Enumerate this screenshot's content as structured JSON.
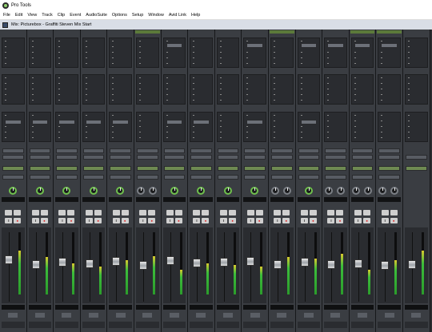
{
  "window": {
    "title": "Pro Tools"
  },
  "menu": [
    "File",
    "Edit",
    "View",
    "Track",
    "Clip",
    "Event",
    "AudioSuite",
    "Options",
    "Setup",
    "Window",
    "Avid Link",
    "Help"
  ],
  "document": {
    "title": "Mix: Picturebox - Graffiti Steven Mix Start"
  },
  "labels": {
    "inserts_ae": "INSERTS A-E",
    "inserts_fj": "INSERTS F-J",
    "sends_ae": "SENDS A-E",
    "io": "I / O",
    "auto": "AUTO",
    "no_group": "no group",
    "pan_label": "pan",
    "solo": "S",
    "mute": "M",
    "dyn": "dyn"
  },
  "strips": [
    {
      "name": "kick 1",
      "color": "#3a3d42",
      "send": "Bus 1",
      "input": "no input",
      "output": "Drums bus",
      "auto": "auto read",
      "pan": "< 0 >",
      "level_left": "-8.4",
      "level_right": "-6.5",
      "knob": "green",
      "fader_frac": 0.58,
      "meter_frac": 0.7
    },
    {
      "name": "snare 1",
      "color": "#3a3d42",
      "send": "Reverb",
      "input": "no input",
      "output": "Drums bus",
      "auto": "auto read",
      "pan": "< 0 >",
      "level_left": "-2.7",
      "level_right": "-6.5",
      "knob": "green",
      "fader_frac": 0.5,
      "meter_frac": 0.6
    },
    {
      "name": "rack tom 1",
      "color": "#3a3d42",
      "send": "Reverb",
      "input": "no input",
      "output": "Drums bus",
      "auto": "auto read",
      "pan": "< 0 >",
      "level_left": "-6.4",
      "level_right": "-11.4",
      "knob": "green",
      "fader_frac": 0.55,
      "meter_frac": 0.5
    },
    {
      "name": "floor tom 1",
      "color": "#3a3d42",
      "send": "Reverb",
      "input": "no input",
      "output": "Drums bus",
      "auto": "auto read",
      "pan": "< 100",
      "level_left": "-7.8",
      "level_right": "-0.7",
      "knob": "green",
      "fader_frac": 0.52,
      "meter_frac": 0.45
    },
    {
      "name": "overhead 1",
      "color": "#3a3d42",
      "send": "Reverb",
      "input": "no input",
      "output": "Drums bus",
      "auto": "auto read",
      "pan": "< 0 >",
      "level_left": "-4.6",
      "level_right": "-11.6",
      "knob": "green",
      "fader_frac": 0.56,
      "meter_frac": 0.55
    },
    {
      "name": "Drums bus",
      "color": "#5c7a3a",
      "send": "",
      "input": "Drums bus",
      "output": "1-2",
      "auto": "auto read",
      "pan": "<100 100>",
      "level_left": "0.1",
      "level_right": "-15.8",
      "knob": "gray",
      "fader_frac": 0.48,
      "meter_frac": 0.62
    },
    {
      "name": "bass 1",
      "color": "#3a3d42",
      "send": "Reverb",
      "input": "no input",
      "output": "1-2",
      "auto": "auto read",
      "pan": "< 0 >",
      "level_left": "-3.9",
      "level_right": "-6.3",
      "knob": "green",
      "fader_frac": 0.57,
      "meter_frac": 0.4,
      "insert": "Pusa Multi"
    },
    {
      "name": "gtr 1 1",
      "color": "#3a3d42",
      "send": "Reverb",
      "input": "no input",
      "output": "Gtr Bus",
      "auto": "auto read",
      "pan": "< 40",
      "level_left": "-6.4",
      "level_right": "-1.8",
      "knob": "green",
      "fader_frac": 0.53,
      "meter_frac": 0.5
    },
    {
      "name": "gtr 2 1",
      "color": "#3a3d42",
      "send": "",
      "input": "no input",
      "output": "Gtr Bus",
      "auto": "auto read",
      "pan": "40 >",
      "level_left": "-10.5",
      "level_right": "-3.4",
      "knob": "green",
      "fader_frac": 0.55,
      "meter_frac": 0.48
    },
    {
      "name": "gtr solo ta",
      "color": "#3a3d42",
      "send": "Reverb",
      "input": "no input",
      "output": "Gtr Bus",
      "auto": "auto read",
      "pan": "30 >",
      "level_left": "-2.5",
      "level_right": "-0.9",
      "knob": "green",
      "fader_frac": 0.56,
      "meter_frac": 0.45,
      "insert": "Pusa Mult"
    },
    {
      "name": "Gtr Bus",
      "color": "#5c7a3a",
      "send": "",
      "input": "Gtr Bus",
      "output": "1-2",
      "auto": "auto read",
      "pan": "<100 100>",
      "level_left": "-3.3",
      "level_right": "-6.2",
      "knob": "gray",
      "fader_frac": 0.5,
      "meter_frac": 0.6
    },
    {
      "name": "leadvocal 1",
      "color": "#3a3d42",
      "send": "Vox Reverb",
      "input": "no input",
      "output": "1-2",
      "auto": "auto read",
      "pan": "< 0 >",
      "level_left": "-2.6",
      "level_right": "-8.0",
      "knob": "green",
      "fader_frac": 0.54,
      "meter_frac": 0.58,
      "insert": "LIS EB"
    },
    {
      "name": "Reverb",
      "color": "#3a3d42",
      "send": "",
      "input": "Reverb",
      "output": "1-2",
      "auto": "auto read",
      "pan": "<100 100>",
      "level_left": "-4.3",
      "level_right": "-7.6",
      "knob": "gray",
      "fader_frac": 0.5,
      "meter_frac": 0.65,
      "insert": "AIR Reverb"
    },
    {
      "name": "Slap",
      "color": "#5c7a3a",
      "send": "",
      "input": "Slap",
      "output": "1-2",
      "auto": "auto read",
      "pan": "<100 100>",
      "level_left": "-5.7",
      "level_right": "-13.2",
      "knob": "gray",
      "fader_frac": 0.52,
      "meter_frac": 0.4,
      "insert": "AmpSlap"
    },
    {
      "name": "Reverb",
      "color": "#5c7a3a",
      "send": "",
      "input": "Reverb",
      "output": "1-2",
      "auto": "auto read",
      "pan": "<100 100>",
      "level_left": "-1.1",
      "level_right": "-9.9",
      "knob": "gray",
      "fader_frac": 0.49,
      "meter_frac": 0.55,
      "insert": "D-Verb"
    },
    {
      "name": "Master",
      "color": "#3a3d42",
      "send": "",
      "input": "",
      "output": "1-2",
      "auto": "auto read",
      "pan": "",
      "level_left": "0.6",
      "level_right": "",
      "knob": "none",
      "fader_frac": 0.5,
      "meter_frac": 0.7
    }
  ]
}
